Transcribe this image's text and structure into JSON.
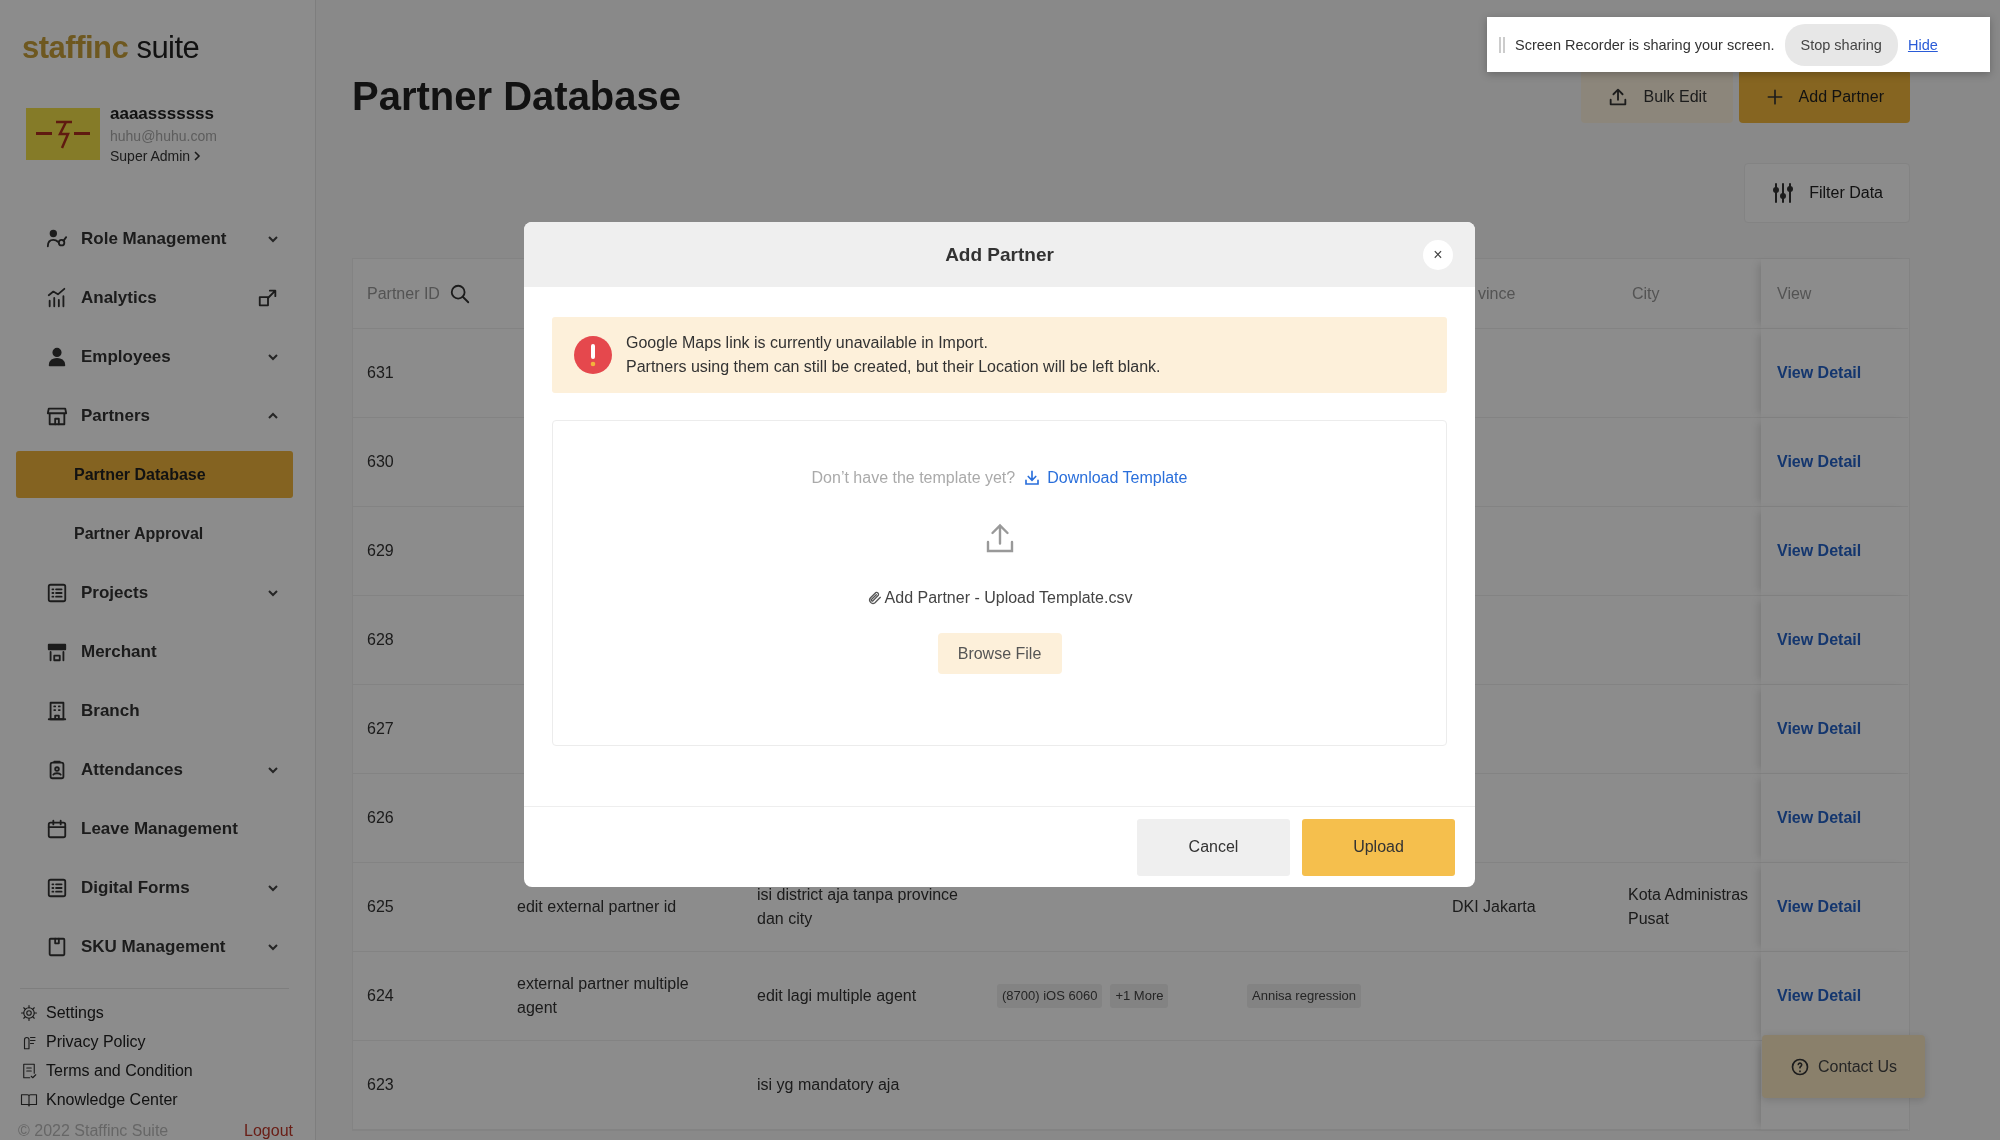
{
  "logo": {
    "brand": "staffinc",
    "product": "suite"
  },
  "profile": {
    "name": "aaaasssssss",
    "email": "huhu@huhu.com",
    "role": "Super Admin"
  },
  "sidebar": {
    "items": [
      {
        "label": "Role Management",
        "kind": "collapsible",
        "expanded": false
      },
      {
        "label": "Analytics",
        "kind": "external"
      },
      {
        "label": "Employees",
        "kind": "collapsible",
        "expanded": false
      },
      {
        "label": "Partners",
        "kind": "collapsible",
        "expanded": true,
        "children": [
          {
            "label": "Partner Database",
            "selected": true
          },
          {
            "label": "Partner Approval",
            "selected": false
          }
        ]
      },
      {
        "label": "Projects",
        "kind": "collapsible",
        "expanded": false
      },
      {
        "label": "Merchant",
        "kind": "plain"
      },
      {
        "label": "Branch",
        "kind": "plain"
      },
      {
        "label": "Attendances",
        "kind": "collapsible",
        "expanded": false
      },
      {
        "label": "Leave Management",
        "kind": "plain"
      },
      {
        "label": "Digital Forms",
        "kind": "collapsible",
        "expanded": false
      },
      {
        "label": "SKU Management",
        "kind": "collapsible",
        "expanded": false
      }
    ],
    "footer_links": [
      "Settings",
      "Privacy Policy",
      "Terms and Condition",
      "Knowledge Center"
    ],
    "copyright": "© 2022 Staffinc Suite",
    "logout": "Logout"
  },
  "page": {
    "title": "Partner Database",
    "actions": [
      {
        "label": "Bulk Edit",
        "kind": "secondary"
      },
      {
        "label": "Add Partner",
        "kind": "primary"
      }
    ],
    "filter_button": "Filter Data"
  },
  "table": {
    "columns": {
      "partner_id": "Partner ID",
      "province": "vince",
      "city": "City",
      "view": "View"
    },
    "rows": [
      {
        "partner_id": "631",
        "view": "View Detail"
      },
      {
        "partner_id": "630",
        "view": "View Detail"
      },
      {
        "partner_id": "629",
        "view": "View Detail"
      },
      {
        "partner_id": "628",
        "view": "View Detail"
      },
      {
        "partner_id": "627",
        "view": "View Detail"
      },
      {
        "partner_id": "626",
        "view": "View Detail"
      },
      {
        "partner_id": "625",
        "column_2": "edit external partner id",
        "column_3": "isi district aja tanpa province dan city",
        "province": "DKI Jakarta",
        "city": "Kota Administras Pusat",
        "view": "View Detail"
      },
      {
        "partner_id": "624",
        "column_2": "external partner multiple agent",
        "column_3": "edit lagi multiple agent",
        "column_4": [
          "(8700) iOS 6060",
          "+1 More"
        ],
        "column_5": [
          "Annisa regression"
        ],
        "view": "View Detail"
      },
      {
        "partner_id": "623",
        "column_3": "isi yg mandatory aja"
      }
    ]
  },
  "contact_button": "Contact Us",
  "modal": {
    "title": "Add Partner",
    "close": "×",
    "alert": [
      "Google Maps link is currently unavailable in Import.",
      "Partners using them can still be created, but their Location will be left blank."
    ],
    "template_prompt": "Don’t have the template yet?",
    "download_link": "Download Template",
    "file_name": "Add Partner - Upload Template.csv",
    "browse_button": "Browse File",
    "buttons": [
      {
        "label": "Cancel",
        "kind": "secondary"
      },
      {
        "label": "Upload",
        "kind": "primary"
      }
    ]
  },
  "recorder_banner": {
    "message": "Screen Recorder is sharing your screen.",
    "stop_button": "Stop sharing",
    "hide_link": "Hide"
  }
}
